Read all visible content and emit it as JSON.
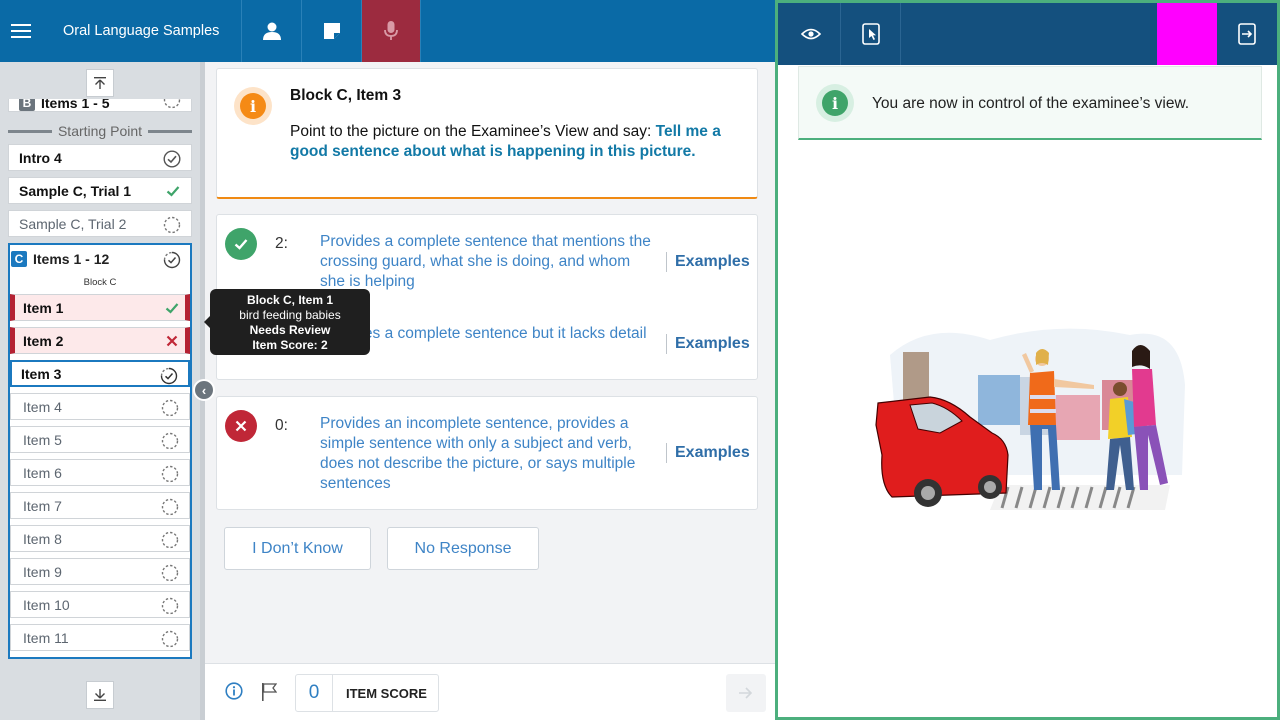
{
  "app": {
    "title": "Oral Language Samples"
  },
  "nav": {
    "block_b_label": "Items 1 - 5",
    "block_b_letter": "B",
    "starting_point": "Starting Point",
    "items": [
      {
        "label": "Intro 4",
        "status": "complete"
      },
      {
        "label": "Sample C, Trial 1",
        "status": "correct"
      },
      {
        "label": "Sample C, Trial 2",
        "status": "pending"
      }
    ],
    "block_c": {
      "letter": "C",
      "label": "Items 1 - 12",
      "sub_label": "Block C",
      "items": [
        {
          "label": "Item 1",
          "status": "correct"
        },
        {
          "label": "Item 2",
          "status": "incorrect"
        },
        {
          "label": "Item 3",
          "status": "in-progress"
        },
        {
          "label": "Item 4",
          "status": "pending"
        },
        {
          "label": "Item 5",
          "status": "pending"
        },
        {
          "label": "Item 6",
          "status": "pending"
        },
        {
          "label": "Item 7",
          "status": "pending"
        },
        {
          "label": "Item 8",
          "status": "pending"
        },
        {
          "label": "Item 9",
          "status": "pending"
        },
        {
          "label": "Item 10",
          "status": "pending"
        },
        {
          "label": "Item 11",
          "status": "pending"
        }
      ]
    }
  },
  "tooltip": {
    "line1": "Block C, Item 1",
    "line2": "bird feeding babies",
    "line3": "Needs Review",
    "line4": "Item Score: 2"
  },
  "prompt": {
    "title": "Block C, Item 3",
    "instruction": "Point to the picture on the Examinee’s View and say:",
    "say": "Tell me a good sentence about what is happening in this picture."
  },
  "scores": [
    {
      "value": "2:",
      "description": "Provides a complete sentence that mentions the crossing guard, what she is doing, and whom she is helping",
      "examples": "Examples"
    },
    {
      "value": "1:",
      "description": "Provides a complete sentence but it lacks detail",
      "examples": "Examples"
    },
    {
      "value": "0:",
      "description": "Provides an incomplete sentence, provides a simple sentence with only a subject and verb, does not describe the picture, or says multiple sentences",
      "examples": "Examples"
    }
  ],
  "buttons": {
    "dont_know": "I Don’t Know",
    "no_response": "No Response"
  },
  "footer": {
    "item_score_value": "0",
    "item_score_label": "ITEM SCORE"
  },
  "examinee": {
    "notice": "You are now in control of the examinee’s view."
  },
  "colors": {
    "app_bar": "#0a6aa6",
    "active_tab": "#9c2b3f",
    "examinee_bar": "#14507e",
    "examinee_border": "#4caf7d",
    "accent_orange": "#f58a15",
    "correct_green": "#3fa46a",
    "incorrect_red": "#c02737",
    "magenta": "#ff00ff"
  },
  "icons": {
    "menu": "hamburger-icon",
    "examinee": "person-icon",
    "notes": "note-icon",
    "audio": "microphone-icon",
    "view": "eye-icon",
    "control": "touch-screen-icon",
    "exit": "exit-icon"
  }
}
